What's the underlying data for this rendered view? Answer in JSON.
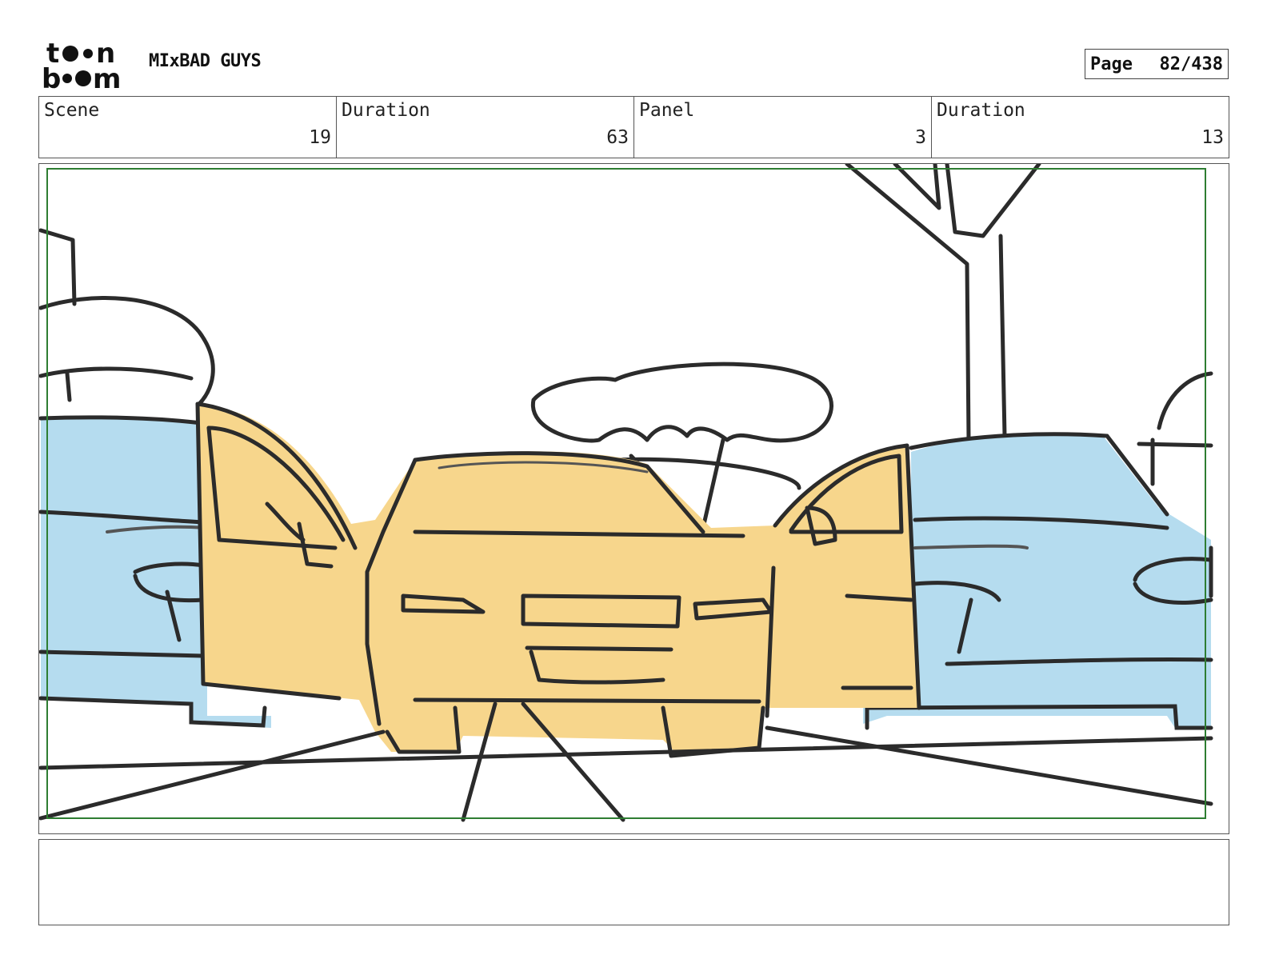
{
  "header": {
    "logo_icon": "toon-boom-logo",
    "project_title": "MIxBAD GUYS",
    "page_label": "Page",
    "page_number": "82/438"
  },
  "info": {
    "scene_label": "Scene",
    "scene_value": "19",
    "scene_duration_label": "Duration",
    "scene_duration_value": "63",
    "panel_label": "Panel",
    "panel_value": "3",
    "panel_duration_label": "Duration",
    "panel_duration_value": "13"
  },
  "panel": {
    "image_icon": "storyboard-sketch-cars",
    "colors": {
      "yellow_car": "#f7d68c",
      "blue_car": "#b5dcef",
      "line": "#2b2b2b",
      "safe_frame": "#2e7d32"
    }
  },
  "notes": {
    "text": ""
  }
}
